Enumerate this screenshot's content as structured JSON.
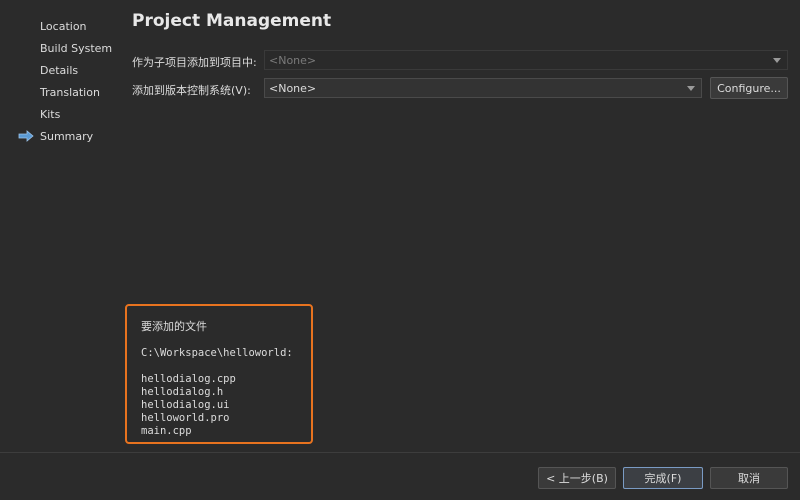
{
  "sidebar": {
    "items": [
      {
        "label": "Location",
        "active": false
      },
      {
        "label": "Build System",
        "active": false
      },
      {
        "label": "Details",
        "active": false
      },
      {
        "label": "Translation",
        "active": false
      },
      {
        "label": "Kits",
        "active": false
      },
      {
        "label": "Summary",
        "active": true
      }
    ],
    "active_icon": "right-arrow-icon",
    "accent": "#5b9bd5"
  },
  "page": {
    "title": "Project Management"
  },
  "form": {
    "subproject_label": "作为子项目添加到项目中:",
    "subproject_value": "<None>",
    "vcs_label": "添加到版本控制系统(V):",
    "vcs_value": "<None>",
    "configure_label": "Configure..."
  },
  "files": {
    "heading": "要添加的文件",
    "directory": "C:\\Workspace\\helloworld:",
    "list": [
      "hellodialog.cpp",
      "hellodialog.h",
      "hellodialog.ui",
      "helloworld.pro",
      "main.cpp"
    ],
    "border_color": "#e8731f"
  },
  "footer": {
    "back_label": "< 上一步(B)",
    "finish_label": "完成(F)",
    "cancel_label": "取消"
  }
}
